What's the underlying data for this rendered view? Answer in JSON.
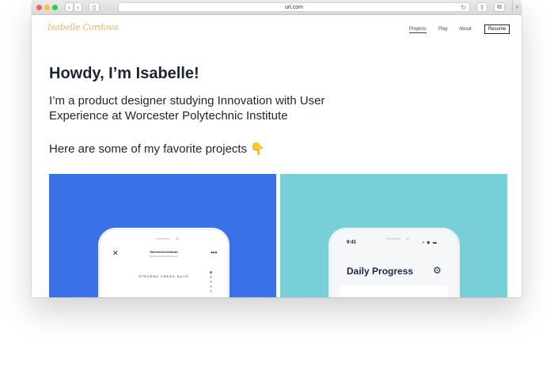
{
  "browser": {
    "url": "url.com",
    "reload_icon": "reload-icon",
    "new_tab_symbol": "+"
  },
  "site": {
    "logo": "Isabelle Cordova",
    "nav": [
      {
        "label": "Projects",
        "active": true
      },
      {
        "label": "Play"
      },
      {
        "label": "About"
      }
    ],
    "resume_label": "Resume"
  },
  "hero": {
    "heading": "Howdy, I’m Isabelle!",
    "intro": "I’m a product designer studying Innovation with User Experience at Worcester Polytechnic Institute",
    "favorites": "Here are some of my favorite projects",
    "emoji": "👇"
  },
  "projects": [
    {
      "bg": "#3b71e6",
      "app_title": "StevensCreekAuto",
      "app_sub": "@StevensCreekAuto.com",
      "brand": "STEVENS CREEK AUTO"
    },
    {
      "bg": "#79cfd8",
      "time": "9:41",
      "status": "▪ ◉ ▬",
      "title": "Daily Progress"
    }
  ],
  "colors": {
    "accent_logo": "#e9b56b",
    "heading_text": "#1d2433"
  }
}
